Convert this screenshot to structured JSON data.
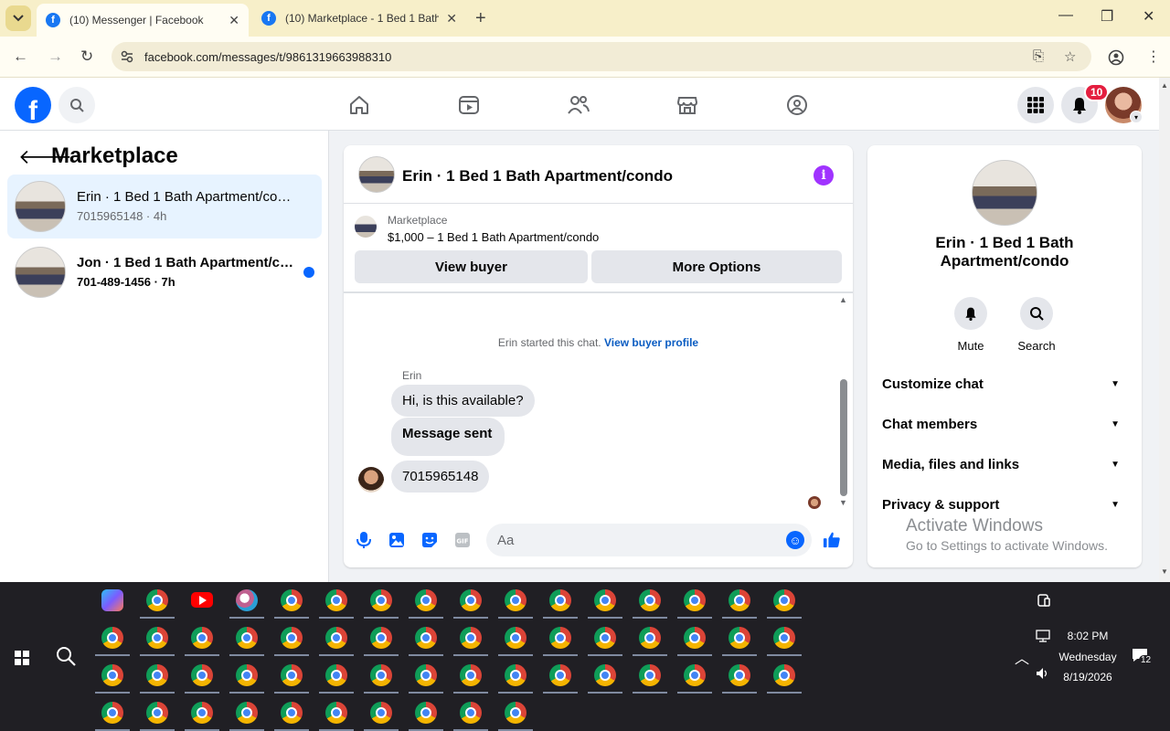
{
  "browser": {
    "tabs": [
      {
        "label": "(10) Messenger | Facebook",
        "active": true
      },
      {
        "label": "(10) Marketplace - 1 Bed 1 Bath",
        "active": false
      }
    ],
    "url": "facebook.com/messages/t/9861319663988310"
  },
  "header": {
    "notification_count": "10"
  },
  "left_panel": {
    "title": "Marketplace",
    "conversations": [
      {
        "name": "Erin · 1 Bed 1 Bath Apartment/condo",
        "subtitle": "7015965148 · 4h",
        "active": true,
        "unread": false
      },
      {
        "name": "Jon · 1 Bed 1 Bath Apartment/condo",
        "subtitle": "701-489-1456 · 7h",
        "active": false,
        "unread": true
      }
    ]
  },
  "chat": {
    "title": "Erin · 1 Bed 1 Bath Apartment/condo",
    "listing_label": "Marketplace",
    "listing_price": "$1,000 – 1 Bed 1 Bath Apartment/condo",
    "view_buyer_label": "View buyer",
    "more_options_label": "More Options",
    "system_text": "Erin started this chat.",
    "system_link": "View buyer profile",
    "sender_name": "Erin",
    "messages": [
      "Hi, is this available?",
      "Message sent",
      "7015965148"
    ],
    "composer_placeholder": "Aa"
  },
  "right_panel": {
    "name_line1": "Erin · 1 Bed 1 Bath",
    "name_line2": "Apartment/condo",
    "mute_label": "Mute",
    "search_label": "Search",
    "sections": [
      "Customize chat",
      "Chat members",
      "Media, files and links",
      "Privacy & support"
    ]
  },
  "watermark": {
    "line1": "Activate Windows",
    "line2": "Go to Settings to activate Windows."
  },
  "taskbar": {
    "time": "8:02 PM",
    "day": "Wednesday",
    "date": "8/19/2026",
    "notif_count": "12"
  },
  "colors": {
    "fb_blue": "#0866ff",
    "active_conv": "#e7f3ff",
    "info_purple": "#a033ff",
    "taskbar_bg": "#201f24"
  }
}
